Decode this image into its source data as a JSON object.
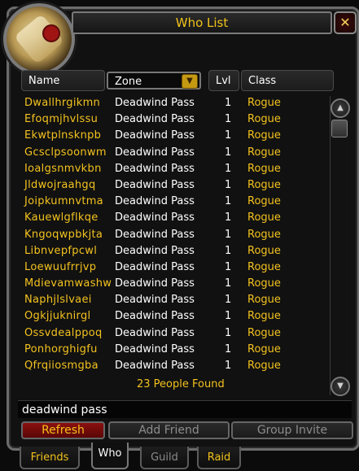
{
  "window": {
    "title": "Who List",
    "close_label": "✕"
  },
  "columns": {
    "name": "Name",
    "zone": "Zone",
    "lvl": "Lvl",
    "class": "Class"
  },
  "rows": [
    {
      "name": "Dwallhrgikmn",
      "zone": "Deadwind Pass",
      "lvl": "1",
      "class": "Rogue"
    },
    {
      "name": "Efoqmjhvlssu",
      "zone": "Deadwind Pass",
      "lvl": "1",
      "class": "Rogue"
    },
    {
      "name": "Ekwtplnsknpb",
      "zone": "Deadwind Pass",
      "lvl": "1",
      "class": "Rogue"
    },
    {
      "name": "Gcsclpsoonwm",
      "zone": "Deadwind Pass",
      "lvl": "1",
      "class": "Rogue"
    },
    {
      "name": "Ioalgsnmvkbn",
      "zone": "Deadwind Pass",
      "lvl": "1",
      "class": "Rogue"
    },
    {
      "name": "Jldwojraahgq",
      "zone": "Deadwind Pass",
      "lvl": "1",
      "class": "Rogue"
    },
    {
      "name": "Joipkumnvtma",
      "zone": "Deadwind Pass",
      "lvl": "1",
      "class": "Rogue"
    },
    {
      "name": "Kauewlgflkqe",
      "zone": "Deadwind Pass",
      "lvl": "1",
      "class": "Rogue"
    },
    {
      "name": "Kngoqwpbkjta",
      "zone": "Deadwind Pass",
      "lvl": "1",
      "class": "Rogue"
    },
    {
      "name": "Libnvepfpcwl",
      "zone": "Deadwind Pass",
      "lvl": "1",
      "class": "Rogue"
    },
    {
      "name": "Loewuufrrjvp",
      "zone": "Deadwind Pass",
      "lvl": "1",
      "class": "Rogue"
    },
    {
      "name": "Mdievamwashw",
      "zone": "Deadwind Pass",
      "lvl": "1",
      "class": "Rogue"
    },
    {
      "name": "Naphjlslvaei",
      "zone": "Deadwind Pass",
      "lvl": "1",
      "class": "Rogue"
    },
    {
      "name": "Ogkjjuknirgl",
      "zone": "Deadwind Pass",
      "lvl": "1",
      "class": "Rogue"
    },
    {
      "name": "Ossvdealppoq",
      "zone": "Deadwind Pass",
      "lvl": "1",
      "class": "Rogue"
    },
    {
      "name": "Ponhorghigfu",
      "zone": "Deadwind Pass",
      "lvl": "1",
      "class": "Rogue"
    },
    {
      "name": "Qfrqiiosmgba",
      "zone": "Deadwind Pass",
      "lvl": "1",
      "class": "Rogue"
    }
  ],
  "found_text": "23 People Found",
  "search": {
    "value": "deadwind pass"
  },
  "buttons": {
    "refresh": "Refresh",
    "add_friend": "Add Friend",
    "group_invite": "Group Invite"
  },
  "tabs": {
    "friends": "Friends",
    "who": "Who",
    "guild": "Guild",
    "raid": "Raid"
  },
  "icons": {
    "portrait": "scroll-portrait-icon",
    "dropdown": "dropdown-arrow-icon",
    "scroll_up": "scroll-up-icon",
    "scroll_down": "scroll-down-icon"
  },
  "colors": {
    "gold": "#f3c21f",
    "red_button": "#8a1010"
  }
}
